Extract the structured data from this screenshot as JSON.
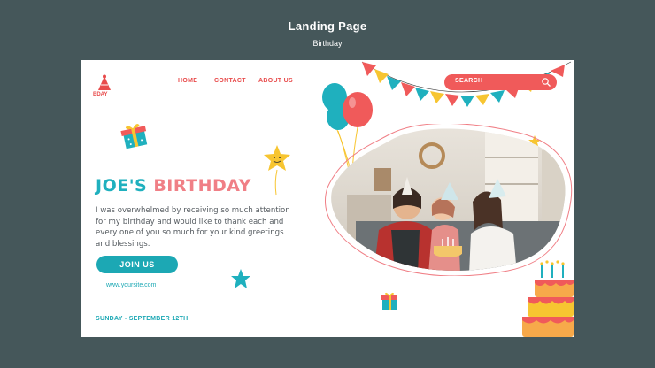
{
  "frame": {
    "title": "Landing Page",
    "subtitle": "Birthday"
  },
  "page": {
    "logo_text": "BDAY",
    "nav": [
      "HOME",
      "CONTACT",
      "ABOUT US"
    ],
    "search": {
      "label": "SEARCH",
      "icon": "search-icon"
    },
    "headline": {
      "part1": "JOE'S",
      "part2": "BIRTHDAY"
    },
    "body": "I was overwhelmed by receiving so much attention for my birthday and would like to thank each and every one of you so much for your kind greetings and blessings.",
    "cta": "JOIN US",
    "website": "www.yoursite.com",
    "date": "SUNDAY - SEPTEMBER 12TH"
  },
  "colors": {
    "background": "#45575a",
    "teal": "#1ca8b4",
    "coral": "#f05a5a",
    "pink": "#f07f86",
    "yellow": "#f7c531"
  }
}
